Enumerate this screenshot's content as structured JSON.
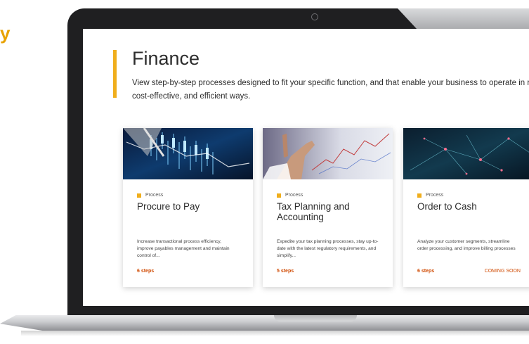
{
  "corner_text": "y",
  "page": {
    "title": "Finance",
    "description": "View step-by-step processes designed to fit your specific function, and that enable your business to operate in rapid, cost-effective, and efficient ways."
  },
  "cards": [
    {
      "tag": "Process",
      "title": "Procure to Pay",
      "description": "Increase transactional process efficiency, improve payables management and maintain control of...",
      "steps": "6 steps",
      "badge": "",
      "image_theme": "stock-market-chart"
    },
    {
      "tag": "Process",
      "title": "Tax Planning and Accounting",
      "description": "Expedite your tax planning processes, stay up-to-date with the latest regulatory requirements, and simplify...",
      "steps": "5 steps",
      "badge": "",
      "image_theme": "hand-touching-chart"
    },
    {
      "tag": "Process",
      "title": "Order to Cash",
      "description": "Analyze your customer segments, streamline order processing, and improve billing processes",
      "steps": "6 steps",
      "badge": "COMING SOON",
      "image_theme": "network-lines"
    }
  ],
  "colors": {
    "accent": "#f0ae1c",
    "steps": "#d04a02",
    "corner_text": "#e8a200"
  }
}
